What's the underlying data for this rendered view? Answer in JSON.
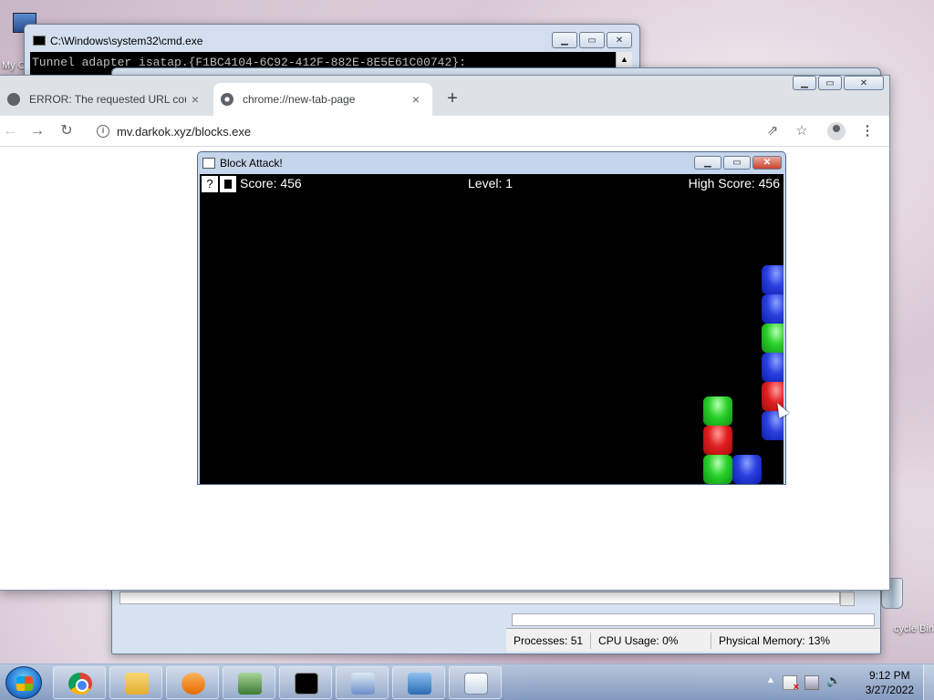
{
  "desktop": {
    "my_computer_label": "My C",
    "recycle_label": "cycle Bin"
  },
  "cmd": {
    "title": "C:\\Windows\\system32\\cmd.exe",
    "console_line": "Tunnel adapter isatap.{F1BC4104-6C92-412F-882E-8E5E61C00742}:"
  },
  "taskmgr": {
    "processes": "Processes: 51",
    "cpu": "CPU Usage: 0%",
    "memory": "Physical Memory: 13%"
  },
  "chrome": {
    "tabs": [
      {
        "label": "ERROR: The requested URL could",
        "active": false
      },
      {
        "label": "chrome://new-tab-page",
        "active": true
      }
    ],
    "new_tab": "+",
    "url": "mv.darkok.xyz/blocks.exe",
    "icons": {
      "back": "←",
      "forward": "→",
      "reload": "↻",
      "share": "⇗",
      "star": "☆",
      "menu": "⋮",
      "close": "×"
    }
  },
  "game": {
    "title": "Block Attack!",
    "help": "?",
    "score": "Score: 456",
    "level": "Level: 1",
    "high_score": "High Score: 456",
    "block_colors": {
      "blue": "#2a3fe0",
      "green": "#29d12a",
      "red": "#e11f1f"
    }
  },
  "taskbar": {
    "apps": [
      "chrome",
      "explorer",
      "media-player",
      "task-manager",
      "cmd",
      "remote-desktop",
      "control-panel",
      "document"
    ],
    "time": "9:12 PM",
    "date": "3/27/2022"
  }
}
